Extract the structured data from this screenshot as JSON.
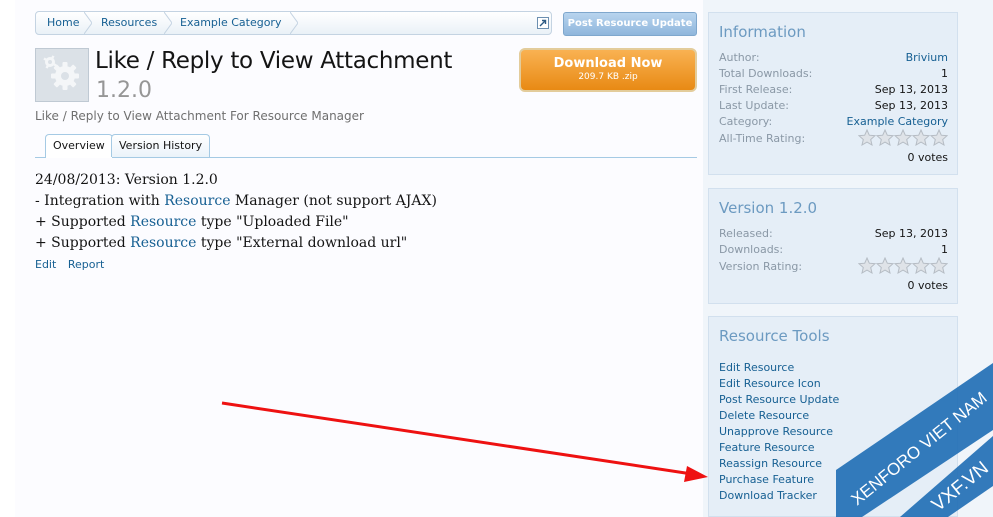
{
  "breadcrumb": {
    "items": [
      "Home",
      "Resources",
      "Example Category"
    ]
  },
  "header": {
    "post_update_label": "Post Resource Update",
    "title": "Like / Reply to View Attachment",
    "version": "1.2.0",
    "tagline": "Like / Reply to View Attachment For Resource Manager",
    "download_label": "Download Now",
    "download_file": "209.7 KB .zip"
  },
  "tabs": [
    {
      "label": "Overview",
      "active": true
    },
    {
      "label": "Version History",
      "active": false
    }
  ],
  "content": {
    "line1": "24/08/2013: Version 1.2.0",
    "line2_pre": "- Integration with ",
    "line2_link": "Resource",
    "line2_post": " Manager (not support AJAX)",
    "line3_pre": "+ Supported ",
    "line3_link": "Resource",
    "line3_post": " type \"Uploaded File\"",
    "line4_pre": "+ Supported ",
    "line4_link": "Resource",
    "line4_post": " type \"External download url\"",
    "edit_label": "Edit",
    "report_label": "Report"
  },
  "info": {
    "title": "Information",
    "author_label": "Author:",
    "author": "Brivium",
    "downloads_label": "Total Downloads:",
    "downloads": "1",
    "first_release_label": "First Release:",
    "first_release": "Sep 13, 2013",
    "last_update_label": "Last Update:",
    "last_update": "Sep 13, 2013",
    "category_label": "Category:",
    "category": "Example Category",
    "rating_label": "All-Time Rating:",
    "rating_stars": 0,
    "votes": "0 votes"
  },
  "version_box": {
    "title": "Version 1.2.0",
    "released_label": "Released:",
    "released": "Sep 13, 2013",
    "downloads_label": "Downloads:",
    "downloads": "1",
    "rating_label": "Version Rating:",
    "rating_stars": 0,
    "votes": "0 votes"
  },
  "tools": {
    "title": "Resource Tools",
    "items": [
      "Edit Resource",
      "Edit Resource Icon",
      "Post Resource Update",
      "Delete Resource",
      "Unapprove Resource",
      "Feature Resource",
      "Reassign Resource",
      "Purchase Feature",
      "Download Tracker"
    ]
  },
  "watermark": {
    "line1": "XENFORO VIET NAM",
    "line2": "VXF.VN"
  },
  "colors": {
    "link": "#176093",
    "download_orange": "#f0a030",
    "arrow_red": "#ee1111",
    "sidebar_bg": "#e5eef7"
  },
  "icons": [
    "gear-icon",
    "jump-to-page-icon",
    "star-icon",
    "arrow-annotation"
  ]
}
